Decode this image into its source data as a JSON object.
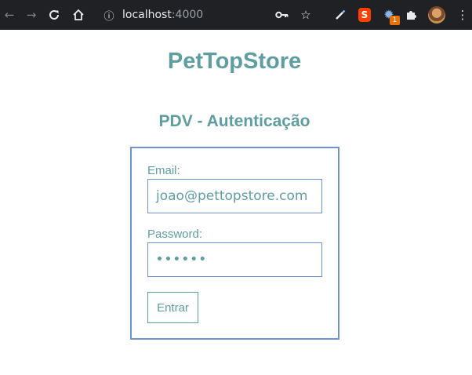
{
  "browser": {
    "url_host": "localhost",
    "url_port": ":4000",
    "icons": {
      "back": "back-arrow-icon",
      "forward": "forward-arrow-icon",
      "reload": "reload-icon",
      "home": "home-icon",
      "info": "site-info-icon",
      "key": "key-icon",
      "star": "bookmark-star-icon",
      "pen": "pen-extension-icon",
      "svelte": "svelte-extension-icon",
      "gear_ext": "gear-extension-icon",
      "puzzle": "extensions-puzzle-icon",
      "avatar": "profile-avatar",
      "menu": "kebab-menu-icon"
    },
    "svelte_ext_letter": "S",
    "gear_ext_badge": "1"
  },
  "page": {
    "brand": "PetTopStore",
    "subtitle": "PDV - Autenticação"
  },
  "login": {
    "email_label": "Email:",
    "email_value": "joao@pettopstore.com",
    "password_label": "Password:",
    "password_mask": "••••••",
    "submit_label": "Entrar"
  },
  "colors": {
    "accent_teal": "#5f9ea0",
    "border_blue": "#6f93d6",
    "browser_bar": "#202124"
  }
}
